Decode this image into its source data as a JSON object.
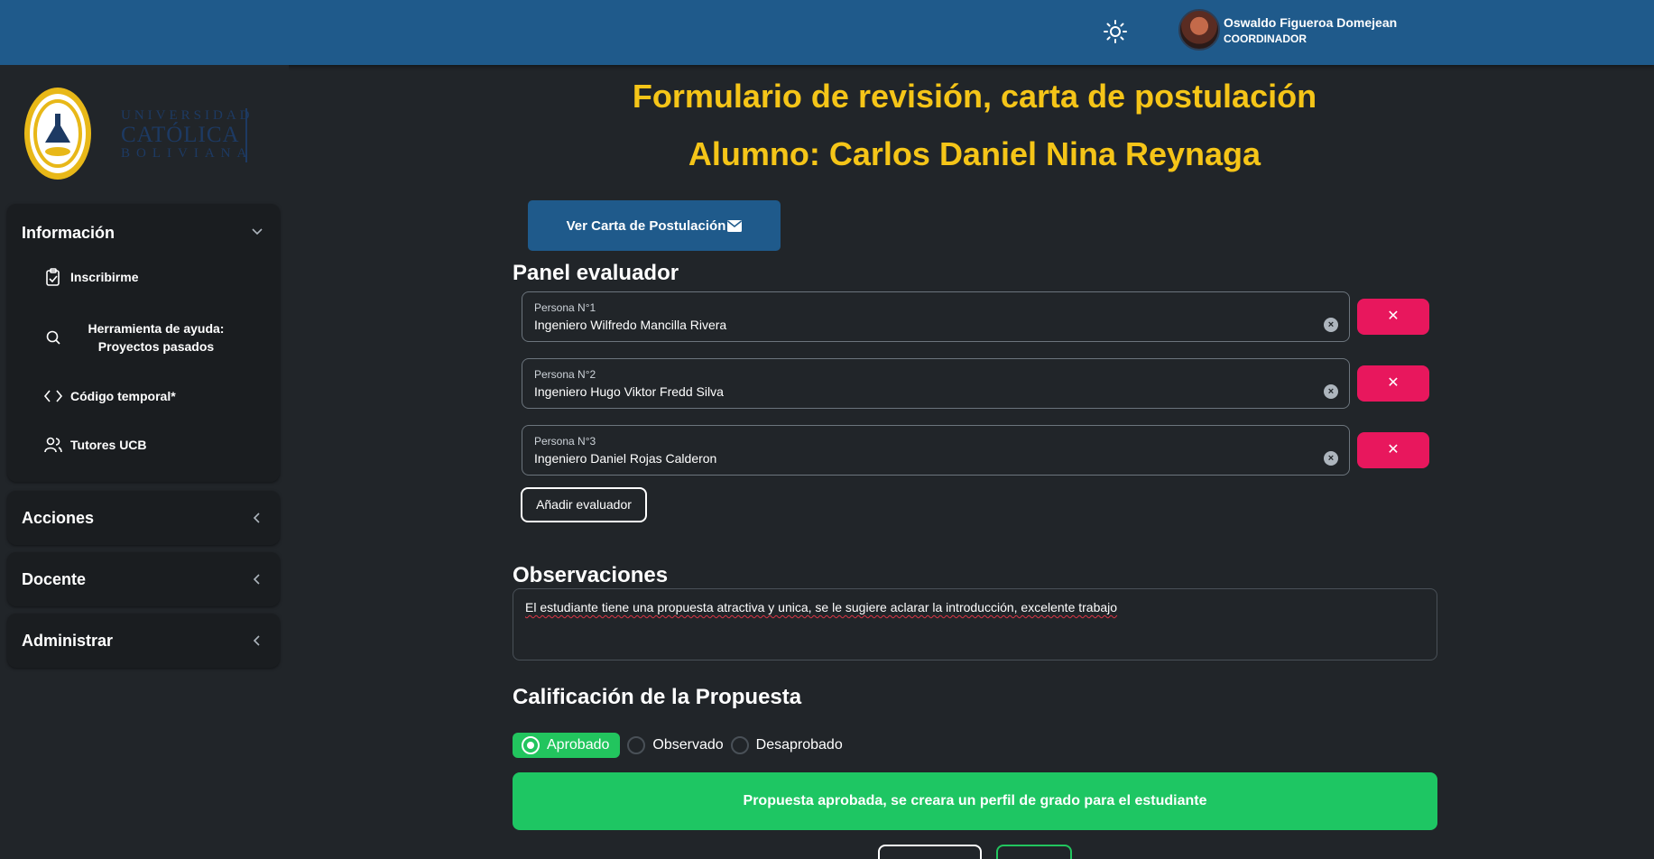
{
  "header": {
    "user_name": "Oswaldo Figueroa Domejean",
    "user_role": "COORDINADOR"
  },
  "logo": {
    "line1": "UNIVERSIDAD",
    "line2": "CATÓLICA",
    "line3": "BOLIVIANA"
  },
  "sidebar": {
    "informacion": {
      "label": "Información",
      "items": [
        {
          "label": "Inscribirme",
          "icon": "clipboard-icon"
        },
        {
          "label": "Herramienta de ayuda: Proyectos pasados",
          "icon": "search-icon"
        },
        {
          "label": "Código temporal*",
          "icon": "code-icon"
        },
        {
          "label": "Tutores UCB",
          "icon": "users-icon"
        }
      ]
    },
    "acciones": {
      "label": "Acciones"
    },
    "docente": {
      "label": "Docente"
    },
    "administrar": {
      "label": "Administrar"
    }
  },
  "main": {
    "title": "Formulario de revisión, carta de postulación",
    "student": "Alumno: Carlos Daniel Nina Reynaga",
    "view_letter_button": "Ver Carta de Postulación",
    "panel_title": "Panel evaluador",
    "evaluators": [
      {
        "label": "Persona N°1",
        "value": "Ingeniero Wilfredo Mancilla Rivera"
      },
      {
        "label": "Persona N°2",
        "value": "Ingeniero Hugo Viktor Fredd Silva"
      },
      {
        "label": "Persona N°3",
        "value": "Ingeniero Daniel Rojas Calderon"
      }
    ],
    "delete_symbol": "✕",
    "clear_symbol": "×",
    "add_evaluator_button": "Añadir evaluador",
    "observations_title": "Observaciones",
    "observations_text": "El estudiante tiene una propuesta atractiva y unica, se le sugiere aclarar la introducción, excelente trabajo",
    "grading_title": "Calificación de la Propuesta",
    "grading_options": [
      "Aprobado",
      "Observado",
      "Desaprobado"
    ],
    "grading_selected": "Aprobado",
    "result_banner": "Propuesta aprobada, se creara un perfil de grado para el estudiante"
  },
  "colors": {
    "topbar": "#1f5a8b",
    "title": "#f5c518",
    "delete": "#e8175d",
    "success": "#1ec663"
  }
}
